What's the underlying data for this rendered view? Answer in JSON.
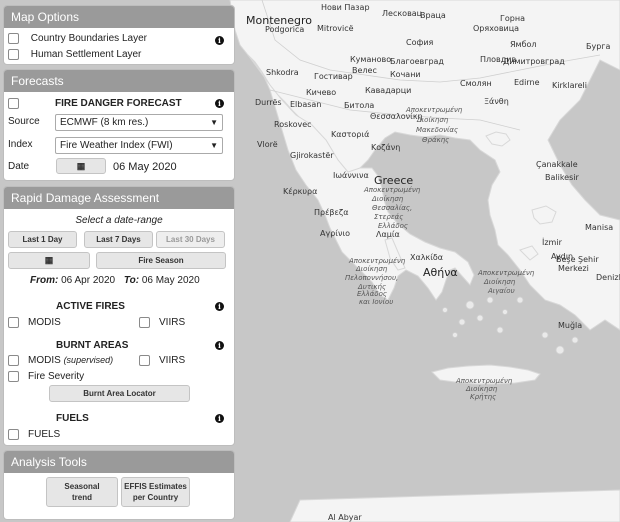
{
  "map": {
    "labels": [
      {
        "text": "Montenegro",
        "cls": "big"
      },
      {
        "text": "Нови Пазар",
        "cls": ""
      },
      {
        "text": "Лесковац",
        "cls": ""
      },
      {
        "text": "Враца",
        "cls": ""
      },
      {
        "text": "Горна",
        "cls": ""
      },
      {
        "text": "Оряховица",
        "cls": ""
      },
      {
        "text": "Podgorica",
        "cls": ""
      },
      {
        "text": "Mitrovicë",
        "cls": ""
      },
      {
        "text": "София",
        "cls": ""
      },
      {
        "text": "Ямбол",
        "cls": ""
      },
      {
        "text": "Бурга",
        "cls": ""
      },
      {
        "text": "Куманово",
        "cls": ""
      },
      {
        "text": "Благоевград",
        "cls": ""
      },
      {
        "text": "Пловдив",
        "cls": ""
      },
      {
        "text": "Димитровград",
        "cls": ""
      },
      {
        "text": "Shkodra",
        "cls": ""
      },
      {
        "text": "Гостивар",
        "cls": ""
      },
      {
        "text": "Велес",
        "cls": ""
      },
      {
        "text": "Кочани",
        "cls": ""
      },
      {
        "text": "Смолян",
        "cls": ""
      },
      {
        "text": "Edirne",
        "cls": ""
      },
      {
        "text": "Kirklareli",
        "cls": ""
      },
      {
        "text": "Кичево",
        "cls": ""
      },
      {
        "text": "Кавадарци",
        "cls": ""
      },
      {
        "text": "Durrës",
        "cls": ""
      },
      {
        "text": "Elbasan",
        "cls": ""
      },
      {
        "text": "Битола",
        "cls": ""
      },
      {
        "text": "Αποκεντρωμένη",
        "cls": "ital"
      },
      {
        "text": "Διοίκηση",
        "cls": "ital"
      },
      {
        "text": "Μακεδονίας",
        "cls": "ital"
      },
      {
        "text": "Θράκης",
        "cls": "ital"
      },
      {
        "text": "Ξάνθη",
        "cls": ""
      },
      {
        "text": "Θεσσαλονίκη",
        "cls": ""
      },
      {
        "text": "Roskovec",
        "cls": ""
      },
      {
        "text": "Καστοριά",
        "cls": ""
      },
      {
        "text": "Vlorë",
        "cls": ""
      },
      {
        "text": "Gjirokastër",
        "cls": ""
      },
      {
        "text": "Κοζάνη",
        "cls": ""
      },
      {
        "text": "Çanakkale",
        "cls": ""
      },
      {
        "text": "Ιωάννινα",
        "cls": ""
      },
      {
        "text": "Balikesir",
        "cls": ""
      },
      {
        "text": "Κέρκυρα",
        "cls": ""
      },
      {
        "text": "Greece",
        "cls": "big"
      },
      {
        "text": "Αποκεντρωμένη",
        "cls": "ital"
      },
      {
        "text": "Διοίκηση",
        "cls": "ital"
      },
      {
        "text": "Θεσσαλίας,",
        "cls": "ital"
      },
      {
        "text": "Στερεάς",
        "cls": "ital"
      },
      {
        "text": "Ελλάδος",
        "cls": "ital"
      },
      {
        "text": "Πρέβεζα",
        "cls": ""
      },
      {
        "text": "Λαμία",
        "cls": ""
      },
      {
        "text": "Manisa",
        "cls": ""
      },
      {
        "text": "Αγρίνιο",
        "cls": ""
      },
      {
        "text": "İzmir",
        "cls": ""
      },
      {
        "text": "Χαλκίδα",
        "cls": ""
      },
      {
        "text": "Αποκεντρωμένη",
        "cls": "ital"
      },
      {
        "text": "Διοίκηση",
        "cls": "ital"
      },
      {
        "text": "Πελοποννήσου,",
        "cls": "ital"
      },
      {
        "text": "Δυτικής",
        "cls": "ital"
      },
      {
        "text": "Ελλάδος",
        "cls": "ital"
      },
      {
        "text": "και Ιονίου",
        "cls": "ital"
      },
      {
        "text": "Αθήνα",
        "cls": "big"
      },
      {
        "text": "Αποκεντρωμένη",
        "cls": "ital"
      },
      {
        "text": "Διοίκηση",
        "cls": "ital"
      },
      {
        "text": "Αιγαίου",
        "cls": "ital"
      },
      {
        "text": "Aydın",
        "cls": ""
      },
      {
        "text": "Beşe Şehir",
        "cls": ""
      },
      {
        "text": "Merkezi",
        "cls": ""
      },
      {
        "text": "Denizli",
        "cls": ""
      },
      {
        "text": "Muğla",
        "cls": ""
      },
      {
        "text": "Αποκεντρωμένη",
        "cls": "ital"
      },
      {
        "text": "Διοίκηση",
        "cls": "ital"
      },
      {
        "text": "Κρήτης",
        "cls": "ital"
      },
      {
        "text": "Al Abyar",
        "cls": ""
      }
    ]
  },
  "map_options": {
    "title": "Map Options",
    "country_boundaries": "Country Boundaries Layer",
    "human_settlement": "Human Settlement Layer",
    "info_icon": "info-icon"
  },
  "forecasts": {
    "title": "Forecasts",
    "fire_danger": "FIRE DANGER FORECAST",
    "source_label": "Source",
    "source_value": "ECMWF (8 km res.)",
    "index_label": "Index",
    "index_value": "Fire Weather Index (FWI)",
    "date_label": "Date",
    "date_value": "06 May 2020",
    "calendar_icon": "calendar-icon"
  },
  "rda": {
    "title": "Rapid Damage Assessment",
    "select_range": "Select a date-range",
    "last1": "Last 1 Day",
    "last7": "Last 7 Days",
    "last30": "Last 30 Days",
    "fire_season": "Fire Season",
    "from_label": "From:",
    "from_value": "06 Apr 2020",
    "to_label": "To:",
    "to_value": "06 May 2020",
    "active_fires": "ACTIVE FIRES",
    "modis": "MODIS",
    "viirs": "VIIRS",
    "burnt_areas": "BURNT AREAS",
    "modis_ba": "MODIS",
    "supervised": "(supervised)",
    "viirs_ba": "VIIRS",
    "fire_severity": "Fire Severity",
    "burnt_locator": "Burnt Area Locator",
    "fuels_heading": "FUELS",
    "fuels": "FUELS"
  },
  "analysis": {
    "title": "Analysis Tools",
    "seasonal_line1": "Seasonal",
    "seasonal_line2": "trend",
    "effis_line1": "EFFIS Estimates",
    "effis_line2": "per Country"
  },
  "colors": {
    "sea": "#c7c7c7",
    "land": "#f2f2f2",
    "header": "#9a9a9a"
  }
}
